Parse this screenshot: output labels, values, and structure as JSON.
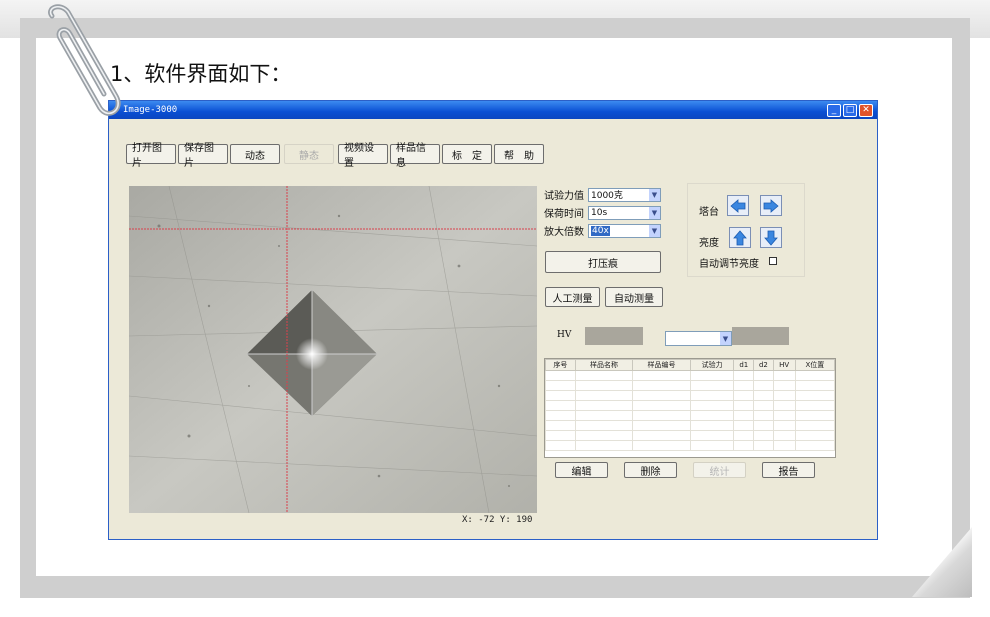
{
  "intro_text": "1、软件界面如下：",
  "window": {
    "title": "Image-3000",
    "controls": [
      "_",
      "□",
      "✕"
    ]
  },
  "toolbar": [
    {
      "label": "打开图片",
      "enabled": true
    },
    {
      "label": "保存图片",
      "enabled": true
    },
    {
      "label": "动态",
      "enabled": true
    },
    {
      "label": "静态",
      "enabled": false
    },
    {
      "label": "视频设置",
      "enabled": true
    },
    {
      "label": "样品信息",
      "enabled": true
    },
    {
      "label": "标　定",
      "enabled": true
    },
    {
      "label": "帮　助",
      "enabled": true
    }
  ],
  "params": {
    "force_label": "试验力值",
    "force_value": "1000克",
    "hold_label": "保荷时间",
    "hold_value": "10s",
    "mag_label": "放大倍数",
    "mag_value": "40x"
  },
  "indent_button": "打压痕",
  "manual_measure": "人工测量",
  "auto_measure": "自动测量",
  "stage_label": "塔台",
  "brightness_label": "亮度",
  "auto_brightness_label": "自动调节亮度",
  "hv_label": "HV",
  "table": {
    "columns": [
      "序号",
      "样品名称",
      "样品编号",
      "试验力",
      "d1",
      "d2",
      "HV",
      "X位置"
    ],
    "rows": 8
  },
  "bottom_buttons": [
    {
      "label": "编辑",
      "enabled": true
    },
    {
      "label": "删除",
      "enabled": true
    },
    {
      "label": "统计",
      "enabled": false
    },
    {
      "label": "报告",
      "enabled": true
    }
  ],
  "coords_text": "X: -72   Y: 190"
}
